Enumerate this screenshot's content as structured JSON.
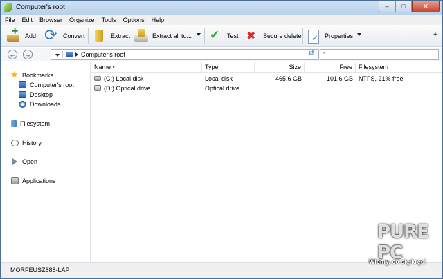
{
  "window": {
    "title": "Computer's root",
    "controls": [
      "–",
      "□",
      "✕"
    ]
  },
  "menu": [
    "File",
    "Edit",
    "Browser",
    "Organize",
    "Tools",
    "Options",
    "Help"
  ],
  "toolbar": {
    "add": "Add",
    "convert": "Convert",
    "extract": "Extract",
    "extract_all": "Extract all to...",
    "test": "Test",
    "secure_delete": "Secure delete",
    "properties": "Properties",
    "more": "+"
  },
  "address": {
    "back": "←",
    "forward": "→",
    "up": "↑",
    "path": "Computer's root",
    "search_value": "*"
  },
  "sidebar": {
    "bookmarks": "Bookmarks",
    "bookmark_items": [
      "Computer's root",
      "Desktop",
      "Downloads"
    ],
    "filesystem": "Filesystem",
    "history": "History",
    "open": "Open",
    "applications": "Applications"
  },
  "table": {
    "columns": [
      "Name <",
      "Type",
      "Size",
      "Free",
      "Filesystem"
    ],
    "rows": [
      {
        "name": "(C:) Local disk",
        "type": "Local disk",
        "size": "465.6 GB",
        "free": "101.6 GB",
        "filesystem": "NTFS, 21% free"
      },
      {
        "name": "(D:) Optical drive",
        "type": "Optical drive",
        "size": "",
        "free": "",
        "filesystem": ""
      }
    ]
  },
  "status": {
    "computer_name": "MORFEUSZ888-LAP"
  },
  "watermark": {
    "logo": "PURE PC",
    "tagline": "Wiemy, co się kręci"
  }
}
